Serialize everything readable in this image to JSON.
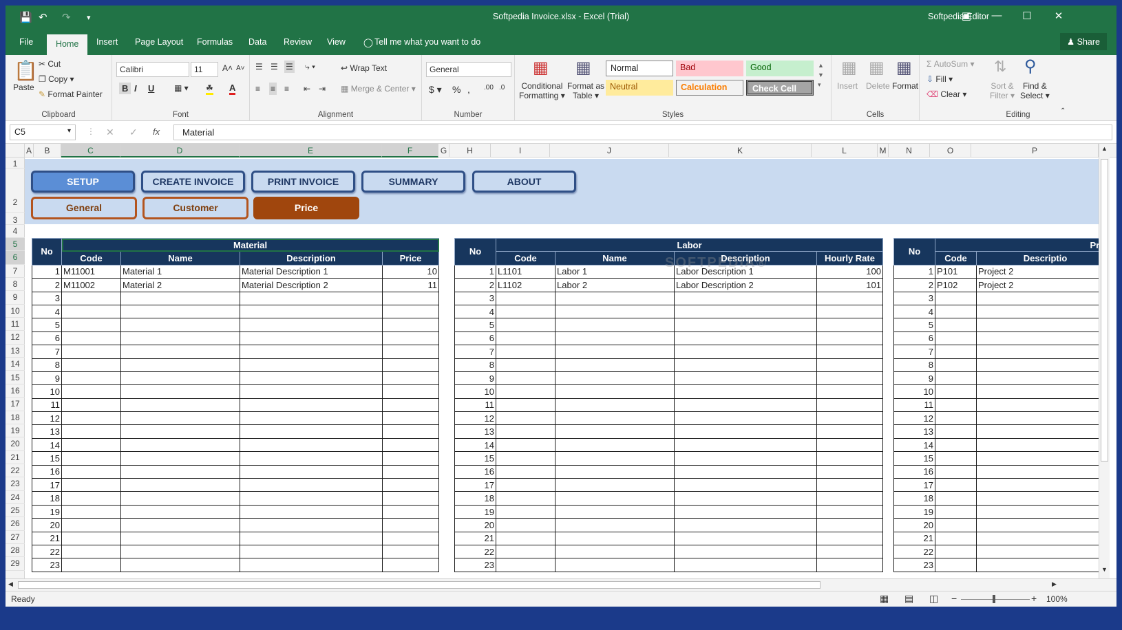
{
  "window": {
    "title": "Softpedia Invoice.xlsx - Excel (Trial)",
    "user": "Softpedia Editor",
    "share": "Share"
  },
  "tabs": [
    "File",
    "Home",
    "Insert",
    "Page Layout",
    "Formulas",
    "Data",
    "Review",
    "View"
  ],
  "tell_me": "Tell me what you want to do",
  "ribbon": {
    "clipboard": {
      "label": "Clipboard",
      "paste": "Paste",
      "cut": "Cut",
      "copy": "Copy",
      "format_painter": "Format Painter"
    },
    "font": {
      "label": "Font",
      "name": "Calibri",
      "size": "11"
    },
    "alignment": {
      "label": "Alignment",
      "wrap": "Wrap Text",
      "merge": "Merge & Center"
    },
    "number": {
      "label": "Number",
      "format": "General"
    },
    "styles": {
      "label": "Styles",
      "cond1": "Conditional",
      "cond2": "Formatting",
      "fmt1": "Format as",
      "fmt2": "Table",
      "cells": [
        "Normal",
        "Bad",
        "Good",
        "Neutral",
        "Calculation",
        "Check Cell"
      ]
    },
    "cells": {
      "label": "Cells",
      "insert": "Insert",
      "delete": "Delete",
      "format": "Format"
    },
    "editing": {
      "label": "Editing",
      "autosum": "AutoSum",
      "fill": "Fill",
      "clear": "Clear",
      "sort1": "Sort &",
      "sort2": "Filter",
      "find1": "Find &",
      "find2": "Select"
    }
  },
  "formula_bar": {
    "name_box": "C5",
    "fx": "fx",
    "value": "Material"
  },
  "columns": [
    "A",
    "B",
    "C",
    "D",
    "E",
    "F",
    "G",
    "H",
    "I",
    "J",
    "K",
    "L",
    "M",
    "N",
    "O",
    "P"
  ],
  "rows": [
    "1",
    "2",
    "3",
    "4",
    "5",
    "6",
    "7",
    "8",
    "9",
    "10",
    "11",
    "12",
    "13",
    "14",
    "15",
    "16",
    "17",
    "18",
    "19",
    "20",
    "21",
    "22",
    "23",
    "24",
    "25",
    "26",
    "27",
    "28",
    "29"
  ],
  "nav": {
    "buttons": [
      "SETUP",
      "CREATE INVOICE",
      "PRINT INVOICE",
      "SUMMARY",
      "ABOUT"
    ],
    "sub": [
      "General",
      "Customer",
      "Price"
    ]
  },
  "material": {
    "title": "Material",
    "no": "No",
    "headers": [
      "Code",
      "Name",
      "Description",
      "Price"
    ],
    "rows": [
      [
        "1",
        "M11001",
        "Material 1",
        "Material Description 1",
        "10"
      ],
      [
        "2",
        "M11002",
        "Material 2",
        "Material Description 2",
        "11"
      ]
    ]
  },
  "labor": {
    "title": "Labor",
    "no": "No",
    "headers": [
      "Code",
      "Name",
      "Description",
      "Hourly Rate"
    ],
    "rows": [
      [
        "1",
        "L1101",
        "Labor 1",
        "Labor Description 1",
        "100"
      ],
      [
        "2",
        "L1102",
        "Labor 2",
        "Labor Description 2",
        "101"
      ]
    ]
  },
  "project": {
    "title": "Proje",
    "no": "No",
    "headers": [
      "Code",
      "Descriptio"
    ],
    "rows": [
      [
        "1",
        "P101",
        "Project 2"
      ],
      [
        "2",
        "P102",
        "Project 2"
      ]
    ]
  },
  "status": {
    "text": "Ready",
    "zoom": "100%"
  }
}
